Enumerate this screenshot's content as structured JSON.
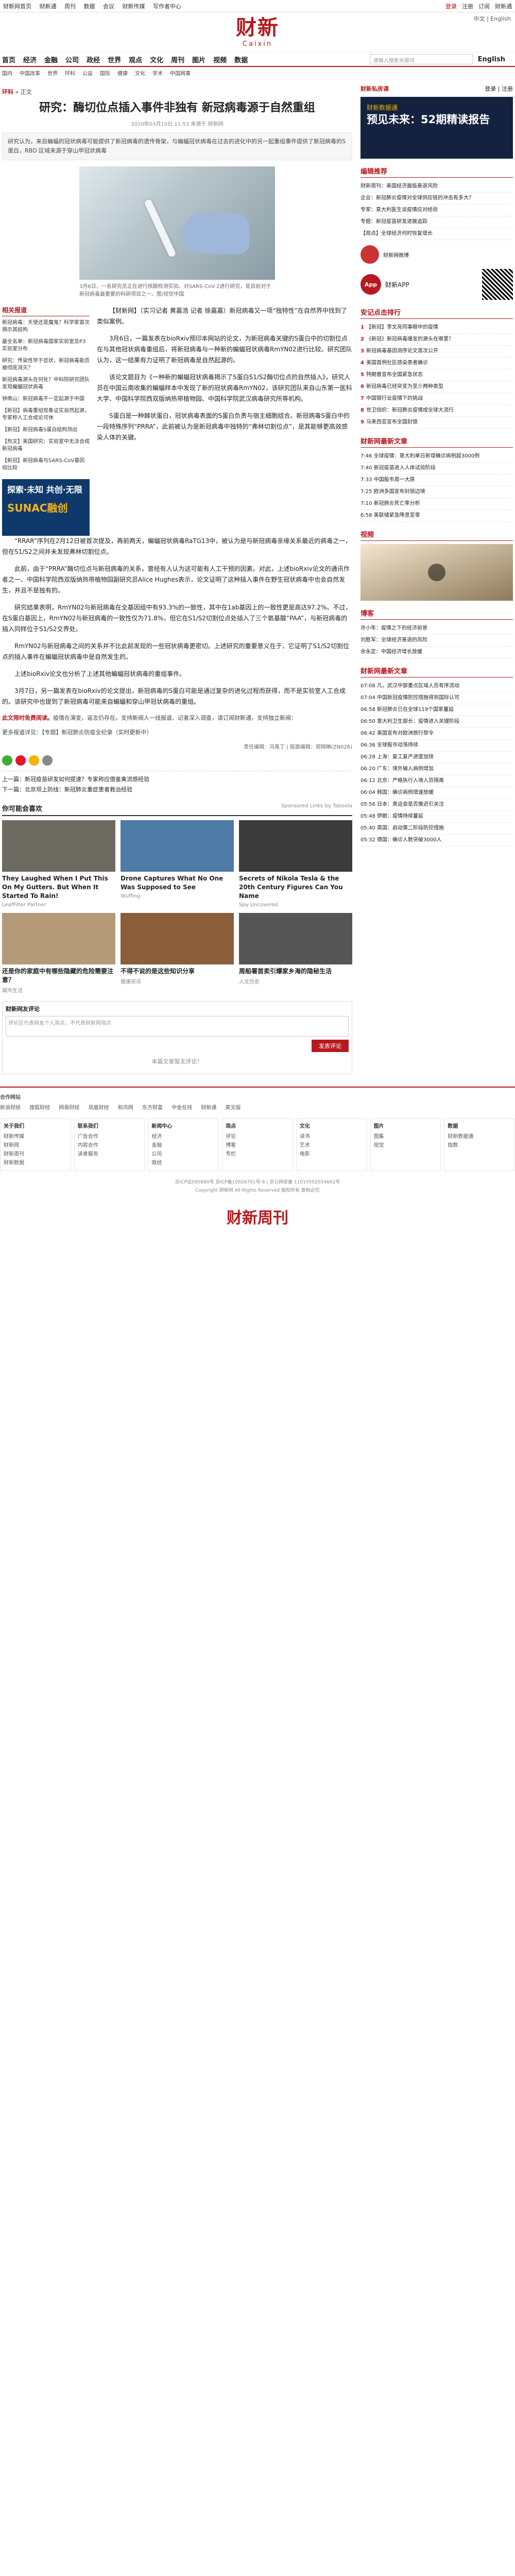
{
  "topbar": {
    "left": [
      "财新网首页",
      "财新通",
      "周刊",
      "数据",
      "会议",
      "财新传媒",
      "写作者中心"
    ],
    "right": [
      "登录",
      "注册",
      "订阅",
      "财新通"
    ]
  },
  "logo": {
    "cn": "财新",
    "en": "Caixin"
  },
  "langs": "中文 | English",
  "nav": {
    "items": [
      "首页",
      "经济",
      "金融",
      "公司",
      "政经",
      "世界",
      "观点",
      "文化",
      "周刊",
      "图片",
      "视频",
      "数据",
      "English"
    ],
    "search_placeholder": "请输入搜索关键词"
  },
  "subnav": [
    "国内",
    "中国改革",
    "世界",
    "环科",
    "公益",
    "国际",
    "健康",
    "文化",
    "学术",
    "中国网事"
  ],
  "crumb": {
    "channel": "环科",
    "sep": " » ",
    "page": "正文"
  },
  "article": {
    "title": "研究：酶切位点插入事件非独有 新冠病毒源于自然重组",
    "meta": "2020年03月10日 11:53 来源于 财新网",
    "summary": "研究认为，来自蝙蝠的冠状病毒可能提供了新冠病毒的遗传骨架，与蝙蝠冠状病毒在过去的进化中的另一起重组事件提供了新冠病毒的S蛋白，RBD 区域来源于穿山甲冠状病毒",
    "caption": "3月6日，一名研究员正在进行核酸检测实验。对SARS-CoV-2进行研究，是目前对于新冠病毒最重要的科研项目之一。图/视觉中国",
    "paragraphs": [
      "【财新网】（实习记者 黄嘉浩 记者 徐嘉嘉）新冠病毒又一项“独特性”在自然界中找到了类似案例。",
      "3月6日，一篇发表在bioRxiv预印本网站的论文，为新冠病毒关键的S蛋白中的切割位点在与其他冠状病毒重组后，将新冠病毒与一种新的蝙蝠冠状病毒RmYN02进行比较。研究团队认为，这一结果有力证明了新冠病毒是自然起源的。",
      "该论文题目为《一种新的蝙蝠冠状病毒揭示了S蛋白S1/S2酶切位点的自然插入》，研究人员在中国云南收集的蝙蝠样本中发现了新的冠状病毒RmYN02，该研究团队来自山东第一医科大学、中国科学院西双版纳热带植物园、中国科学院武汉病毒研究所等机构。",
      "S蛋白是一种棘状蛋白，冠状病毒表面的S蛋白负责与宿主细胞结合。新冠病毒S蛋白中的一段特殊序列“PRRA”，此前被认为是新冠病毒中独特的“弗林切割位点”，是其能够更高效感染人体的关键。",
      "“RRAR”序列在2月12日被首次提及，再前两天，蝙蝠冠状病毒RaTG13中，被认为是与新冠病毒亲缘关系最近的病毒之一，但在S1/S2之间并未发现弗林切割位点。",
      "此前，由于“PRRA”酶切位点与新冠病毒的关系，曾经有人认为这可能有人工干预的因素。对此，上述bioRxiv论文的通讯作者之一、中国科学院西双版纳热带植物园副研究员Alice Hughes表示，论文证明了这种插入事件在野生冠状病毒中也会自然发生，并且不是独有的。",
      "研究结果表明，RmYN02与新冠病毒在全基因组中有93.3%的一致性，其中在1ab基因上的一致性更是高达97.2%。不过，在S蛋白基因上，RmYN02与新冠病毒的一致性仅为71.8%，但它在S1/S2切割位点处插入了三个氨基酸“PAA”，与新冠病毒的插入同样位于S1/S2交界处。",
      "RmYN02与新冠病毒之间的关系并不比此前发现的一些冠状病毒更密切。上述研究的重要意义在于，它证明了S1/S2切割位点的插入事件在蝙蝠冠状病毒中是自然发生的。",
      "上述bioRxiv论文也分析了上述其他蝙蝠冠状病毒的重组事件。",
      "3月7日，另一篇发表在bioRxiv的论文提出，新冠病毒的S蛋白可能是通过复杂的进化过程而获得，而不是实验室人工合成的。该研究中也提到了新冠病毒可能来自蝙蝠和穿山甲冠状病毒的重组。"
    ],
    "note_label": "此文限时免费阅读。",
    "note": "疫情在演变，谣言仍存在。支持新闻人一线报道、记者深入调查，请订阅财新通，支持独立新闻：",
    "more": "更多报道详见：【专题】新冠肺炎防疫全纪录（实时更新中）",
    "editor": "责任编辑：冯禹丁 | 版面编辑：郑翔琳(ZN026)",
    "prev": "上一篇：新冠疫苗研发如何提速？专家称应借鉴禽流感经验",
    "next": "下一篇：北京坝上防线：新冠肺炎重症患者救治经验"
  },
  "left_sidebar": {
    "title": "相关报道",
    "items": [
      "新冠病毒：天使还是魔鬼？科学家首次揭示其结构",
      "最全名单：新冠病毒国家实验室及P3实验室分布",
      "研究：传染性早于症状，新冠病毒能否被彻底消灭？",
      "新冠病毒源头在何处？中科院研究团队发现蝙蝠冠状病毒",
      "钟南山：新冠病毒不一定起源于中国",
      "【新冠】病毒重组现象证实自然起源，专家称人工合成论可休",
      "【新冠】新冠病毒S蛋白结构测出",
      "【热文】美国研究：实验室中无法合成新冠病毒",
      "【新冠】新冠病毒与SARS-CoV基因组比较"
    ],
    "ad": {
      "big": "探索·未知 共创·无限",
      "brand": "SUNAC融创"
    }
  },
  "recommend": {
    "title": "你可能会喜欢",
    "right": "Sponsored Links by Taboola",
    "cards": [
      {
        "t": "They Laughed When I Put This On My Gutters. But When It Started To Rain!",
        "s": "LeafFilter Partner"
      },
      {
        "t": "Drone Captures What No One Was Supposed to See",
        "s": "Wuffing"
      },
      {
        "t": "Secrets of Nikola Tesla & the 20th Century Figures Can You Name",
        "s": "Spy Uncovered"
      },
      {
        "t": "还是你的家庭中有哪些隐藏的危险需要注意？",
        "s": "城市生活"
      },
      {
        "t": "不得不说的是这些知识分享",
        "s": "健康资讯"
      },
      {
        "t": "周船署首卖引爆家乡海的隐秘生活",
        "s": "人文历史"
      }
    ]
  },
  "comment": {
    "title": "财新网友评论",
    "placeholder": "评论区代表网友个人观点，不代表财新网观点",
    "button": "发表评论",
    "empty": "本篇文章暂无评论！"
  },
  "right": {
    "login_title": "财新私房课",
    "login_links": "登录 | 注册",
    "banner": {
      "a": "财新数据通",
      "b": "预见未来：52期精读报告"
    },
    "editor_title": "编辑推荐",
    "editor_items": [
      "财新周刊：美国经济面临衰退风险",
      "企业：新冠肺炎疫情对全球供应链的冲击有多大？",
      "专家：意大利医生谈疫情应对经验",
      "专题：新冠疫苗研发进展追踪",
      "【观点】全球经济何时恢复增长"
    ],
    "app": "财新APP",
    "weibo": "财新网微博",
    "newest_title": "安记点击排行",
    "hot": [
      "【新冠】李文亮同事眼中的疫情",
      "《新冠》新冠病毒爆发的源头在哪里？",
      "新冠病毒基因测序论文首次公开",
      "美国首例社区感染患者确诊",
      "特朗普宣布全国紧急状态",
      "新冠病毒已经突变为至少两种类型",
      "中国银行业疫情下的挑战",
      "世卫组织：新冠肺炎疫情成全球大流行",
      "马来西亚宣布全国封锁"
    ],
    "recent_title": "财新网最新文章",
    "recent": [
      "7:46 全球疫情：意大利单日新增确诊病例超3000例",
      "7:40 新冠疫苗进入人体试验阶段",
      "7:33 中国股市周一大跌",
      "7:25 欧洲多国宣布封锁边境",
      "7:10 新冠肺炎死亡率分析",
      "6:58 美联储紧急降息至零"
    ],
    "video_title": "视频",
    "blog_title": "博客",
    "blog": [
      "许小年：疫情之下的经济前景",
      "刘胜军：全球经济衰退的风险",
      "余永定：中国经济增长放缓"
    ],
    "latest_title": "财新网最新文章",
    "latest": [
      "07:08 凡，武汉中部重点区域人员有序流动",
      "07:04 中国新冠疫情防控措施得到国际认可",
      "06:58 新冠肺炎已在全球119个国家蔓延",
      "06:50 意大利卫生部长：疫情进入关键阶段",
      "06:42 美国宣布对欧洲旅行禁令",
      "06:36 全球股市动荡持续",
      "06:28 上海：复工复产进度加快",
      "06:20 广东：境外输入病例增加",
      "06:12 北京：严格执行入境人员隔离",
      "06:04 韩国：确诊病例增速放缓",
      "05:56 日本：奥运会是否推迟引关注",
      "05:48 伊朗：疫情持续蔓延",
      "05:40 英国：启动第二阶段防控措施",
      "05:32 德国：确诊人数突破3000人"
    ]
  },
  "footer": {
    "links_title": "合作网站",
    "links": [
      "新浪财经",
      "搜狐财经",
      "网易财经",
      "凤凰财经",
      "和讯网",
      "东方财富",
      "中金在线",
      "财新通",
      "英文版"
    ],
    "cols": [
      {
        "h": "关于我们",
        "items": [
          "财新传媒",
          "财新网",
          "财新周刊",
          "财新数据"
        ]
      },
      {
        "h": "联系我们",
        "items": [
          "广告合作",
          "内容合作",
          "读者服务"
        ]
      },
      {
        "h": "新闻中心",
        "items": [
          "经济",
          "金融",
          "公司",
          "政经"
        ]
      },
      {
        "h": "观点",
        "items": [
          "评论",
          "博客",
          "专栏"
        ]
      },
      {
        "h": "文化",
        "items": [
          "读书",
          "艺术",
          "电影"
        ]
      },
      {
        "h": "图片",
        "items": [
          "图集",
          "视觉"
        ]
      },
      {
        "h": "数据",
        "items": [
          "财新数据通",
          "指数"
        ]
      }
    ],
    "copyright": [
      "京ICP证090880号 京ICP备10026701号-8 | 京公网安备 11010502034662号",
      "Copyright 财新网 All Rights Reserved 版权所有 复制必究"
    ],
    "bottom_logo": "财新周刊"
  }
}
